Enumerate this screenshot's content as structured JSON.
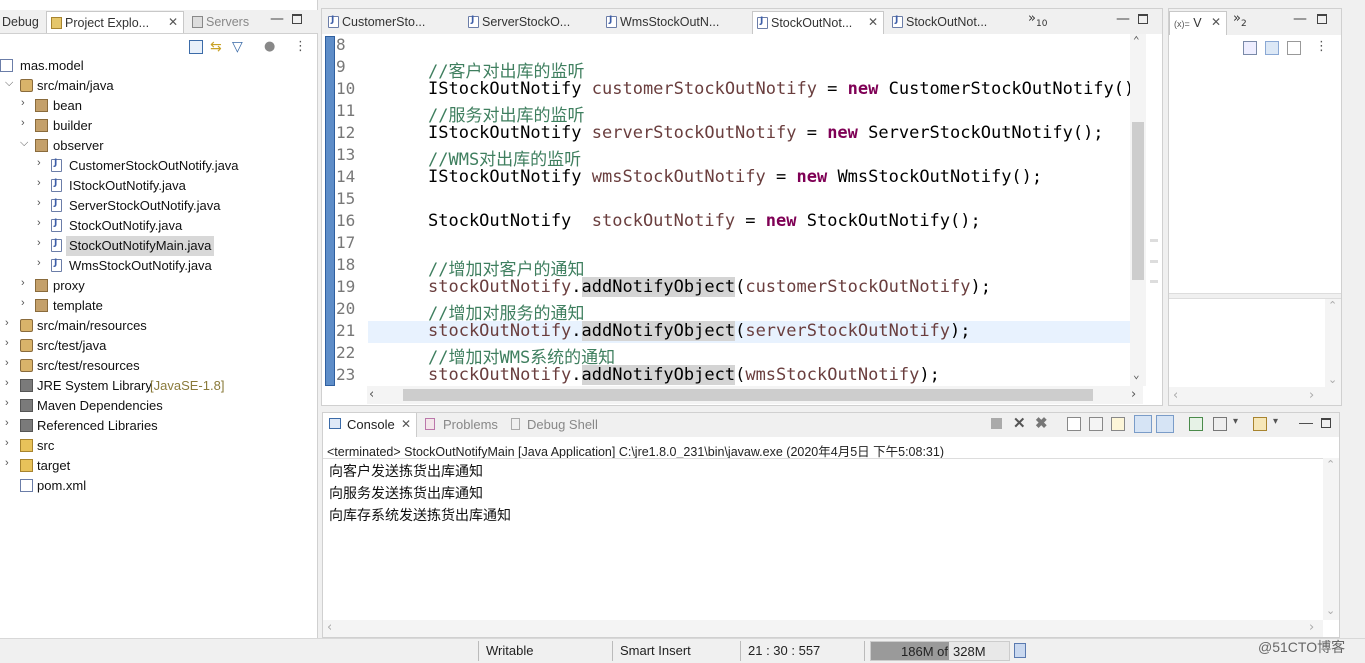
{
  "left_panel": {
    "tabs": [
      {
        "label": "Debug"
      },
      {
        "label": "Project Explo..."
      },
      {
        "label": "Servers"
      }
    ],
    "tree": [
      {
        "label": "mas.model"
      },
      {
        "label": "src/main/java"
      },
      {
        "label": "bean"
      },
      {
        "label": "builder"
      },
      {
        "label": "observer"
      },
      {
        "label": "CustomerStockOutNotify.java"
      },
      {
        "label": "IStockOutNotify.java"
      },
      {
        "label": "ServerStockOutNotify.java"
      },
      {
        "label": "StockOutNotify.java"
      },
      {
        "label": "StockOutNotifyMain.java"
      },
      {
        "label": "WmsStockOutNotify.java"
      },
      {
        "label": "proxy"
      },
      {
        "label": "template"
      },
      {
        "label": "src/main/resources"
      },
      {
        "label": "src/test/java"
      },
      {
        "label": "src/test/resources"
      },
      {
        "label": "JRE System Library",
        "suffix": "[JavaSE-1.8]"
      },
      {
        "label": "Maven Dependencies"
      },
      {
        "label": "Referenced Libraries"
      },
      {
        "label": "src"
      },
      {
        "label": "target"
      },
      {
        "label": "pom.xml"
      }
    ]
  },
  "editor": {
    "tabs": [
      {
        "label": "CustomerSto..."
      },
      {
        "label": "ServerStockO..."
      },
      {
        "label": "WmsStockOutN..."
      },
      {
        "label": "StockOutNot..."
      },
      {
        "label": "StockOutNot..."
      }
    ],
    "overflow_count": "10",
    "lines": [
      {
        "n": "8"
      },
      {
        "n": "9",
        "comment": "//客户对出库的监听"
      },
      {
        "n": "10",
        "type": "IStockOutNotify ",
        "var": "customerStockOutNotify",
        "eq": " = ",
        "kw": "new",
        "rest": " CustomerStockOutNotify();"
      },
      {
        "n": "11",
        "comment": "//服务对出库的监听"
      },
      {
        "n": "12",
        "type": "IStockOutNotify ",
        "var": "serverStockOutNotify",
        "eq": " = ",
        "kw": "new",
        "rest": " ServerStockOutNotify();"
      },
      {
        "n": "13",
        "comment": "//WMS对出库的监听"
      },
      {
        "n": "14",
        "type": "IStockOutNotify ",
        "var": "wmsStockOutNotify",
        "eq": " = ",
        "kw": "new",
        "rest": " WmsStockOutNotify();"
      },
      {
        "n": "15"
      },
      {
        "n": "16",
        "type": "StockOutNotify  ",
        "var": "stockOutNotify",
        "eq": " = ",
        "kw": "new",
        "rest": " StockOutNotify();"
      },
      {
        "n": "17"
      },
      {
        "n": "18",
        "comment": "//增加对客户的通知"
      },
      {
        "n": "19",
        "obj": "stockOutNotify",
        "dot": ".",
        "method": "addNotifyObject",
        "open": "(",
        "arg": "customerStockOutNotify",
        "close": ");"
      },
      {
        "n": "20",
        "comment": "//增加对服务的通知"
      },
      {
        "n": "21",
        "obj": "stockOutNotify",
        "dot": ".",
        "method": "addNotifyObject",
        "open": "(",
        "arg": "serverStockOutNotify",
        "close": ");"
      },
      {
        "n": "22",
        "comment": "//增加对WMS系统的通知"
      },
      {
        "n": "23",
        "obj": "stockOutNotify",
        "dot": ".",
        "method": "addNotifyObject",
        "open": "(",
        "arg": "wmsStockOutNotify",
        "close": ");"
      }
    ]
  },
  "right_panel": {
    "tab_label": "V",
    "tab_prefix": "(x)=",
    "overflow_count": "2"
  },
  "console": {
    "tabs": [
      {
        "label": "Console"
      },
      {
        "label": "Problems"
      },
      {
        "label": "Debug Shell"
      }
    ],
    "header": "<terminated> StockOutNotifyMain [Java Application] C:\\jre1.8.0_231\\bin\\javaw.exe (2020年4月5日 下午5:08:31)",
    "output": [
      "向客户发送拣货出库通知",
      "向服务发送拣货出库通知",
      "向库存系统发送拣货出库通知"
    ]
  },
  "status_bar": {
    "writable": "Writable",
    "insert_mode": "Smart Insert",
    "position": "21 : 30 : 557",
    "heap_used": "186M of ",
    "heap_total": "328M",
    "heap_fraction": 0.567
  },
  "watermark": "@51CTO博客",
  "colors": {
    "comment": "#3f7f5f",
    "keyword": "#7f0055",
    "field": "#6a3e3e",
    "current_line": "#e8f2fe",
    "heap_bar": "#9a9a9a"
  }
}
